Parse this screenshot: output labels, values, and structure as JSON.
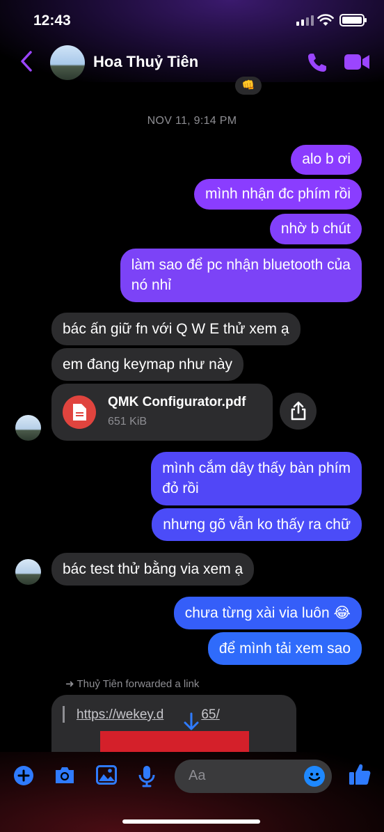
{
  "status": {
    "time": "12:43"
  },
  "header": {
    "contact_name": "Hoa Thuỷ Tiên"
  },
  "reaction_partial": "👊",
  "timestamp": "NOV 11, 9:14 PM",
  "colors": {
    "accent_purple": "#8b3dff",
    "accent_blue": "#2f6bff",
    "incoming_bg": "#2c2c2e"
  },
  "messages": [
    {
      "dir": "out",
      "text": "alo b ơi"
    },
    {
      "dir": "out",
      "text": "mình nhận đc phím rồi"
    },
    {
      "dir": "out",
      "text": "nhờ b chút"
    },
    {
      "dir": "out",
      "text_line1": "làm sao để pc nhận bluetooth của",
      "text_line2": "nó nhỉ"
    },
    {
      "dir": "in",
      "text": "bác ấn giữ fn với Q W E thử xem ạ"
    },
    {
      "dir": "in",
      "text": "em đang keymap như này"
    },
    {
      "dir": "in",
      "type": "file",
      "file_name": "QMK Configurator.pdf",
      "file_size": "651 KiB"
    },
    {
      "dir": "out",
      "text_line1": "mình cắm dây thấy bàn phím",
      "text_line2": "đỏ rồi"
    },
    {
      "dir": "out",
      "text": "nhưng gõ vẫn ko thấy ra chữ"
    },
    {
      "dir": "in",
      "text": "bác test thử bằng via xem ạ"
    },
    {
      "dir": "out",
      "text": "chưa từng xài via luôn 😂"
    },
    {
      "dir": "out",
      "text": "để mình tải xem sao"
    }
  ],
  "forward": {
    "note": "Thuỷ Tiên forwarded a link",
    "url_start": "https://wekey.d",
    "url_end": "65/"
  },
  "composer": {
    "placeholder": "Aa"
  },
  "icons": [
    "back-icon",
    "phone-icon",
    "video-icon",
    "pdf-icon",
    "share-icon",
    "plus-icon",
    "camera-icon",
    "gallery-icon",
    "mic-icon",
    "emoji-icon",
    "like-icon",
    "scroll-down-icon"
  ]
}
